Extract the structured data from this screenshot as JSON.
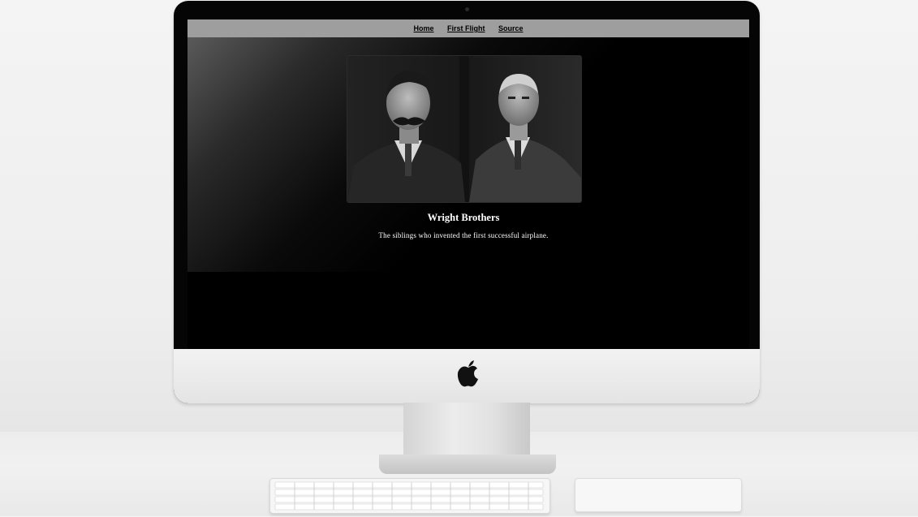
{
  "nav": {
    "items": [
      {
        "label": "Home"
      },
      {
        "label": "First Flight"
      },
      {
        "label": "Source"
      }
    ]
  },
  "hero": {
    "title": "Wright Brothers",
    "subtitle": "The siblings who invented the first successful airplane."
  },
  "colors": {
    "navbar": "#9e9e9e",
    "screen_background": "#000000",
    "text": "#ffffff"
  },
  "icons": {
    "hardware_logo": "apple-logo-icon"
  }
}
